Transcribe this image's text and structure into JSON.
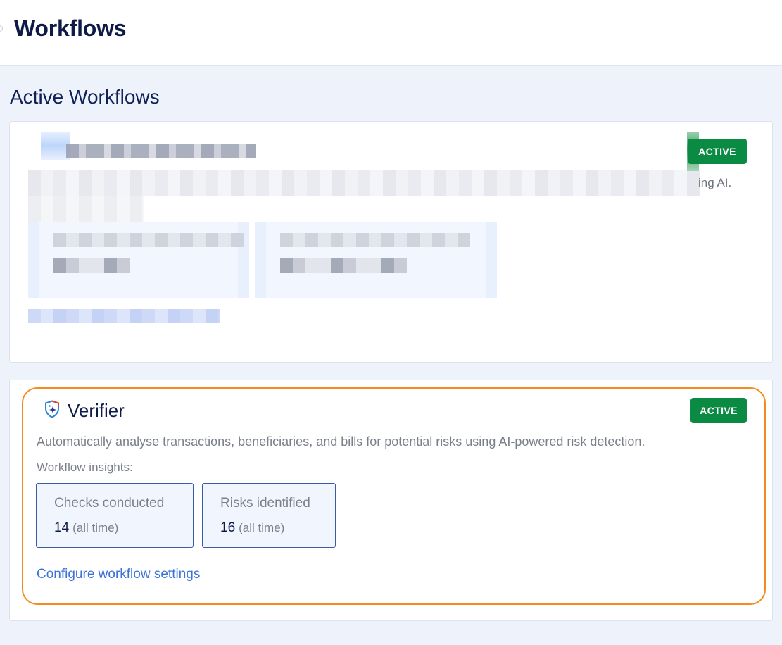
{
  "header": {
    "title": "Workflows"
  },
  "section": {
    "title": "Active Workflows"
  },
  "workflows": [
    {
      "id_hint": "redacted",
      "status": "ACTIVE",
      "description_tail": "ing AI."
    },
    {
      "name": "Verifier",
      "icon": "shield-sparkle-icon",
      "status": "ACTIVE",
      "description": "Automatically analyse transactions, beneficiaries, and bills for potential risks using AI-powered risk detection.",
      "insights_label": "Workflow insights:",
      "stats": [
        {
          "label": "Checks conducted",
          "value": "14",
          "suffix": "(all time)"
        },
        {
          "label": "Risks identified",
          "value": "16",
          "suffix": "(all time)"
        }
      ],
      "configure_link": "Configure workflow settings"
    }
  ],
  "colors": {
    "status_active": "#0b8a43",
    "highlight": "#f58a1f",
    "link": "#3b73d6",
    "stat_border": "#3a5ba8"
  }
}
